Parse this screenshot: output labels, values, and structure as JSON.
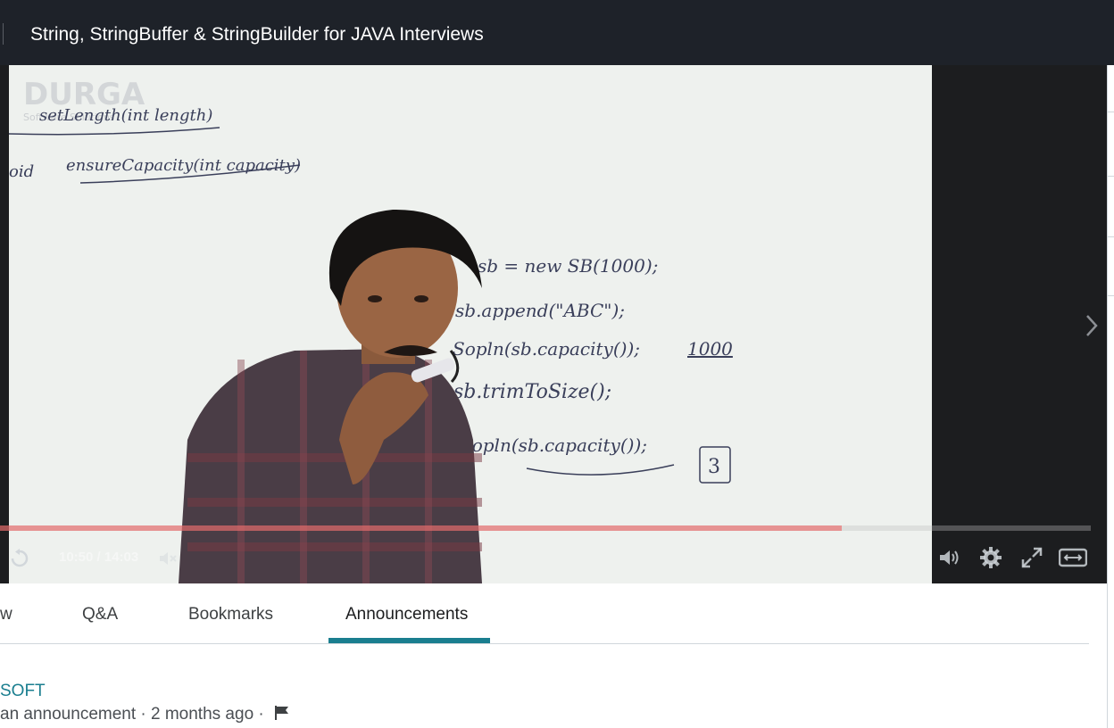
{
  "header": {
    "title": "String, StringBuffer & StringBuilder for JAVA Interviews"
  },
  "video": {
    "time": "10:50 / 14:03",
    "progress_fraction": 0.772,
    "icons": {
      "rewind": "rewind-icon",
      "mute": "volume-muted-icon",
      "volume": "volume-icon",
      "settings": "gear-icon",
      "fullscreen": "expand-icon",
      "theater": "theater-mode-icon",
      "next": "chevron-right-icon"
    },
    "board": {
      "watermark": "DURGA",
      "watermark_sub": "Software Solutions",
      "line1": "setLength(int length)",
      "line2_prefix": "oid",
      "line2": "ensureCapacity(int capacity)",
      "code1": "sb = new SB(1000);",
      "code2": "sb.append(\"ABC\");",
      "code3": "Sopln(sb.capacity());",
      "code3_result": "1000",
      "code4": "sb.trimToSize();",
      "code5": "Sopln(sb.capacity());",
      "code5_result": "3"
    }
  },
  "tabs": [
    {
      "label": "w"
    },
    {
      "label": "Q&A"
    },
    {
      "label": "Bookmarks"
    },
    {
      "label": "Announcements",
      "active": true
    }
  ],
  "announcement": {
    "author": "SOFT",
    "meta": "an announcement · 2 months ago ·"
  }
}
